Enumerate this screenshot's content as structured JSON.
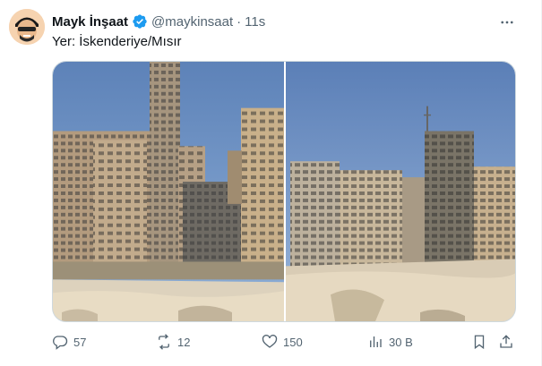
{
  "author": {
    "name": "Mayk İnşaat",
    "handle": "@maykinsaat",
    "separator": "·",
    "time": "11s",
    "verified": true
  },
  "tweet_text": "Yer: İskenderiye/Mısır",
  "media": {
    "count": 2,
    "subject": "apartment buildings by the sea wall"
  },
  "actions": {
    "replies": "57",
    "reposts": "12",
    "likes": "150",
    "views": "30 B"
  },
  "colors": {
    "secondary_text": "#536471",
    "verified_blue": "#1d9bf0",
    "sky": "#6f8fc0"
  }
}
